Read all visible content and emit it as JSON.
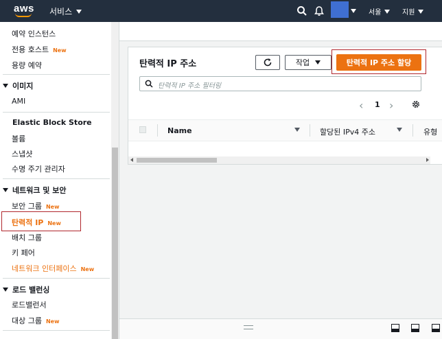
{
  "topbar": {
    "logo": "aws",
    "services_label": "서비스",
    "region_label": "서울",
    "support_label": "지원"
  },
  "sidebar": {
    "items": [
      {
        "label": "예약 인스턴스",
        "new": ""
      },
      {
        "label": "전용 호스트",
        "new": "New"
      },
      {
        "label": "용량 예약",
        "new": ""
      }
    ],
    "sections": [
      {
        "title": "이미지",
        "items": [
          {
            "label": "AMI",
            "new": ""
          }
        ]
      },
      {
        "title": "Elastic Block Store",
        "items": [
          {
            "label": "볼륨",
            "new": ""
          },
          {
            "label": "스냅샷",
            "new": ""
          },
          {
            "label": "수명 주기 관리자",
            "new": ""
          }
        ]
      },
      {
        "title": "네트워크 및 보안",
        "items": [
          {
            "label": "보안 그룹",
            "new": "New"
          },
          {
            "label": "탄력적 IP",
            "new": "New"
          },
          {
            "label": "배치 그룹",
            "new": ""
          },
          {
            "label": "키 페어",
            "new": ""
          },
          {
            "label": "네트워크 인터페이스",
            "new": "New"
          }
        ]
      },
      {
        "title": "로드 밸런싱",
        "items": [
          {
            "label": "로드밸런서",
            "new": ""
          },
          {
            "label": "대상 그룹",
            "new": "New"
          }
        ]
      }
    ]
  },
  "panel": {
    "title": "탄력적 IP 주소",
    "action_label": "작업",
    "primary_label": "탄력적 IP 주소 할당",
    "filter_placeholder": "탄력적 IP 주소 필터링",
    "page": "1",
    "columns": [
      "Name",
      "할당된 IPv4 주소",
      "유형"
    ]
  },
  "colors": {
    "accent": "#ec7211",
    "topbar": "#232f3e",
    "highlight": "#b0262c"
  }
}
